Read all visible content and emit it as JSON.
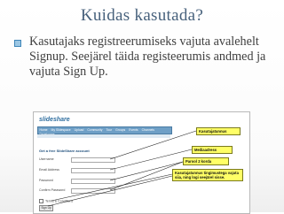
{
  "slide": {
    "title": "Kuidas kasutada?",
    "bullet": "Kasutajaks registreerumiseks vajuta avalehelt Signup. Seejärel täida registeerumis andmed ja vajuta Sign Up."
  },
  "screenshot": {
    "logo": "slideshare",
    "nav": [
      "Home",
      "My Slidespace",
      "Upload",
      "Community",
      "Tour",
      "Groups",
      "Events",
      "Channels",
      "Developers"
    ],
    "form_title": "Get a free SlideShare account",
    "fields": [
      {
        "label": "Username"
      },
      {
        "label": "Email Address"
      },
      {
        "label": "Password"
      },
      {
        "label": "Confirm Password"
      }
    ],
    "terms_label": "Terms & Conditions",
    "signup_button": "Sign Up",
    "callouts": {
      "username": "Kasutajatunnus",
      "email": "Meiliaadress",
      "password": "Parool 2 korda",
      "terms": "Kasutajatunnus tingimustega vajuta siia, ning logi seejärel sisse."
    }
  },
  "colors": {
    "title": "#47617c",
    "body_text": "#404040",
    "callout_fill": "#ffff66",
    "bullet": "#3f86b8"
  }
}
